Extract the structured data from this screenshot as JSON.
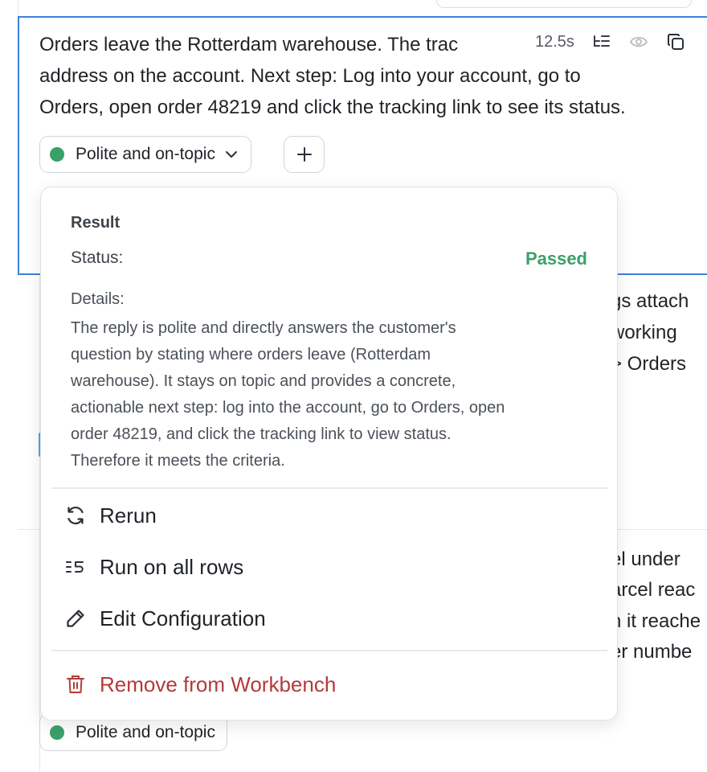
{
  "cell": {
    "lines": [
      "Orders leave the Rotterdam warehouse. The trac",
      "address on the account. Next step: Log into your account, go to",
      "Orders, open order 48219 and click the tracking link to see its status."
    ],
    "duration": "12.5s",
    "chip_label": "Polite and on-topic"
  },
  "background": {
    "row2_fragments": [
      "gs attach",
      " working",
      "> Orders"
    ],
    "row3_fragments": [
      "el under",
      "arcel reac",
      "n it reache",
      "er numbe"
    ],
    "bottom_chip_label": "Polite and on-topic"
  },
  "popover": {
    "result_label": "Result",
    "status_label": "Status:",
    "status_value": "Passed",
    "details_label": "Details:",
    "details_lines": [
      "The reply is polite and directly answers the customer's",
      "question by stating where orders leave (Rotterdam",
      "warehouse). It stays on topic and provides a concrete,",
      "actionable next step: log into the account, go to Orders, open",
      "order 48219, and click the tracking link to view status.",
      "Therefore it meets the criteria."
    ],
    "menu": {
      "rerun": "Rerun",
      "run_all": "Run on all rows",
      "edit": "Edit Configuration",
      "remove": "Remove from Workbench"
    }
  },
  "colors": {
    "accent_blue": "#3b82d6",
    "pass_green": "#3aa06a",
    "danger_red": "#b43a3a"
  },
  "icons": {
    "toolbar": [
      "outline-list-icon",
      "eye-icon",
      "copy-icon"
    ],
    "menu": [
      "refresh-icon",
      "run-all-rows-icon",
      "pencil-icon",
      "trash-icon"
    ]
  }
}
